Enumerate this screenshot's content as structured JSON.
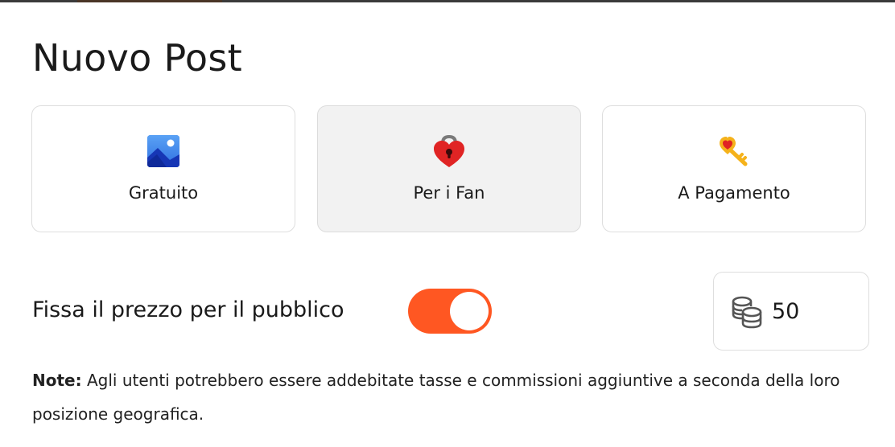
{
  "header": {
    "title": "Nuovo Post"
  },
  "post_types": [
    {
      "label": "Gratuito",
      "icon": "image-icon",
      "selected": false
    },
    {
      "label": "Per i Fan",
      "icon": "heart-lock-icon",
      "selected": true
    },
    {
      "label": "A Pagamento",
      "icon": "key-icon",
      "selected": false
    }
  ],
  "pricing": {
    "label": "Fissa il prezzo per il pubblico",
    "toggle_on": true,
    "toggle_color": "#ff5722",
    "coin_icon": "coins-icon",
    "value": "50"
  },
  "note": {
    "prefix": "Note:",
    "text": " Agli utenti potrebbero essere addebitate tasse e commissioni aggiuntive a seconda della loro posizione geografica."
  }
}
